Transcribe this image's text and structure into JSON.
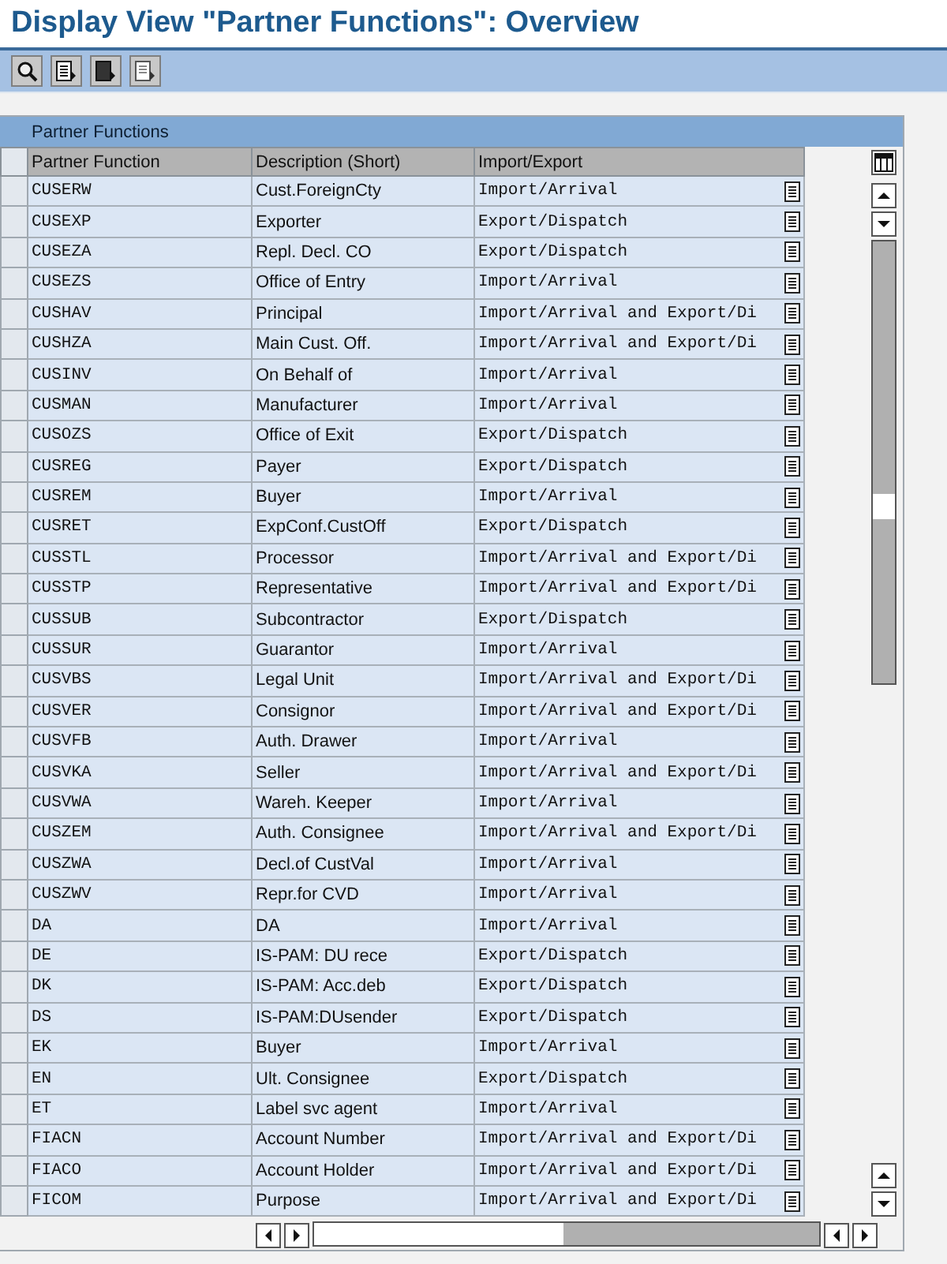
{
  "window": {
    "title": "Display View \"Partner Functions\": Overview"
  },
  "panel": {
    "title": "Partner Functions"
  },
  "table": {
    "columns": [
      "Partner Function",
      "Description (Short)",
      "Import/Export"
    ],
    "rows": [
      {
        "code": "CUSERW",
        "description": "Cust.ForeignCty",
        "direction": "Import/Arrival"
      },
      {
        "code": "CUSEXP",
        "description": "Exporter",
        "direction": "Export/Dispatch"
      },
      {
        "code": "CUSEZA",
        "description": "Repl. Decl. CO",
        "direction": "Export/Dispatch"
      },
      {
        "code": "CUSEZS",
        "description": "Office of Entry",
        "direction": "Import/Arrival"
      },
      {
        "code": "CUSHAV",
        "description": "Principal",
        "direction": "Import/Arrival and Export/Di"
      },
      {
        "code": "CUSHZA",
        "description": "Main Cust. Off.",
        "direction": "Import/Arrival and Export/Di"
      },
      {
        "code": "CUSINV",
        "description": "On Behalf of",
        "direction": "Import/Arrival"
      },
      {
        "code": "CUSMAN",
        "description": "Manufacturer",
        "direction": "Import/Arrival"
      },
      {
        "code": "CUSOZS",
        "description": "Office of Exit",
        "direction": "Export/Dispatch"
      },
      {
        "code": "CUSREG",
        "description": "Payer",
        "direction": "Export/Dispatch"
      },
      {
        "code": "CUSREM",
        "description": "Buyer",
        "direction": "Import/Arrival"
      },
      {
        "code": "CUSRET",
        "description": "ExpConf.CustOff",
        "direction": "Export/Dispatch"
      },
      {
        "code": "CUSSTL",
        "description": "Processor",
        "direction": "Import/Arrival and Export/Di"
      },
      {
        "code": "CUSSTP",
        "description": "Representative",
        "direction": "Import/Arrival and Export/Di"
      },
      {
        "code": "CUSSUB",
        "description": "Subcontractor",
        "direction": "Export/Dispatch"
      },
      {
        "code": "CUSSUR",
        "description": "Guarantor",
        "direction": "Import/Arrival"
      },
      {
        "code": "CUSVBS",
        "description": "Legal Unit",
        "direction": "Import/Arrival and Export/Di"
      },
      {
        "code": "CUSVER",
        "description": "Consignor",
        "direction": "Import/Arrival and Export/Di"
      },
      {
        "code": "CUSVFB",
        "description": "Auth. Drawer",
        "direction": "Import/Arrival"
      },
      {
        "code": "CUSVKA",
        "description": "Seller",
        "direction": "Import/Arrival and Export/Di"
      },
      {
        "code": "CUSVWA",
        "description": "Wareh. Keeper",
        "direction": "Import/Arrival"
      },
      {
        "code": "CUSZEM",
        "description": "Auth. Consignee",
        "direction": "Import/Arrival and Export/Di"
      },
      {
        "code": "CUSZWA",
        "description": "Decl.of CustVal",
        "direction": "Import/Arrival"
      },
      {
        "code": "CUSZWV",
        "description": "Repr.for CVD",
        "direction": "Import/Arrival"
      },
      {
        "code": "DA",
        "description": "DA",
        "direction": "Import/Arrival"
      },
      {
        "code": "DE",
        "description": "IS-PAM: DU rece",
        "direction": "Export/Dispatch"
      },
      {
        "code": "DK",
        "description": "IS-PAM: Acc.deb",
        "direction": "Export/Dispatch"
      },
      {
        "code": "DS",
        "description": "IS-PAM:DUsender",
        "direction": "Export/Dispatch"
      },
      {
        "code": "EK",
        "description": "Buyer",
        "direction": "Import/Arrival"
      },
      {
        "code": "EN",
        "description": "Ult. Consignee",
        "direction": "Export/Dispatch"
      },
      {
        "code": "ET",
        "description": "Label svc agent",
        "direction": "Import/Arrival"
      },
      {
        "code": "FIACN",
        "description": "Account Number",
        "direction": "Import/Arrival and Export/Di"
      },
      {
        "code": "FIACO",
        "description": "Account Holder",
        "direction": "Import/Arrival and Export/Di"
      },
      {
        "code": "FICOM",
        "description": "Purpose",
        "direction": "Import/Arrival and Export/Di"
      }
    ]
  }
}
